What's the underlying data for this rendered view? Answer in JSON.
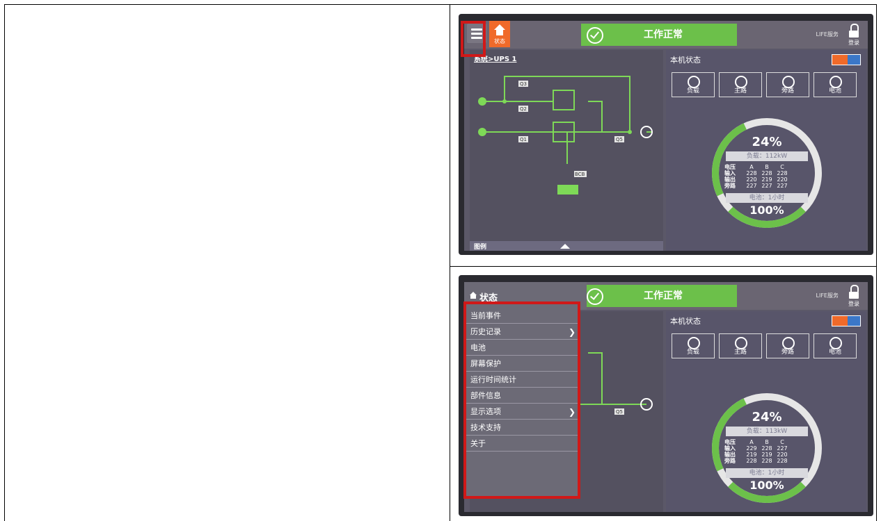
{
  "screen": {
    "status_text": "工作正常",
    "home_label": "状态",
    "life_service": "LIFE服务",
    "login_label": "登录",
    "breadcrumb": "系统>UPS 1",
    "legend_label": "图例",
    "panel_title": "本机状态",
    "modes": [
      "负载",
      "主路",
      "旁路",
      "电池"
    ],
    "diagram_labels": [
      "Q3",
      "Q2",
      "Q1",
      "Q5",
      "BCB"
    ],
    "gauge": {
      "load_percent": "24%",
      "voltage_header": [
        "电压",
        "A",
        "B",
        "C"
      ],
      "battery_label": "电池：1小时",
      "battery_percent": "100%"
    }
  },
  "screen1": {
    "load_text": "负载：112kW",
    "rows": [
      [
        "输入",
        "228",
        "228",
        "228"
      ],
      [
        "输出",
        "220",
        "219",
        "220"
      ],
      [
        "旁路",
        "227",
        "227",
        "227"
      ]
    ]
  },
  "screen2": {
    "header_title": "状态",
    "load_text": "负载：113kW",
    "rows": [
      [
        "输入",
        "229",
        "228",
        "227"
      ],
      [
        "输出",
        "219",
        "219",
        "220"
      ],
      [
        "旁路",
        "228",
        "228",
        "228"
      ]
    ],
    "menu": [
      {
        "label": "当前事件",
        "submenu": false
      },
      {
        "label": "历史记录",
        "submenu": true
      },
      {
        "label": "电池",
        "submenu": false
      },
      {
        "label": "屏幕保护",
        "submenu": false
      },
      {
        "label": "运行时间统计",
        "submenu": false
      },
      {
        "label": "部件信息",
        "submenu": false
      },
      {
        "label": "显示选项",
        "submenu": true
      },
      {
        "label": "技术支持",
        "submenu": false
      },
      {
        "label": "关于",
        "submenu": false
      }
    ]
  },
  "colors": {
    "status_green": "#6cc04a",
    "home_orange": "#f06a2a",
    "highlight_red": "#d01818"
  }
}
